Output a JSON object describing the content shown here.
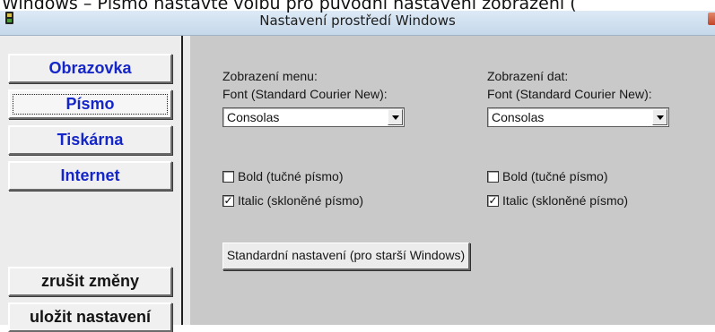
{
  "caption": "Windows – Písmo nastavte volbu pro původní nastavení zobrazení (",
  "window": {
    "title": "Nastavení prostředí Windows"
  },
  "sidebar": {
    "items": [
      {
        "label": "Obrazovka",
        "selected": false
      },
      {
        "label": "Písmo",
        "selected": true
      },
      {
        "label": "Tiskárna",
        "selected": false
      },
      {
        "label": "Internet",
        "selected": false
      }
    ],
    "cancel_label": "zrušit změny",
    "save_label": "uložit nastavení"
  },
  "menu_display": {
    "heading": "Zobrazení menu:",
    "font_label": "Font (Standard Courier New):",
    "font_value": "Consolas",
    "bold_label": "Bold (tučné písmo)",
    "bold_checked": false,
    "italic_label": "Italic (skloněné písmo)",
    "italic_checked": true
  },
  "data_display": {
    "heading": "Zobrazení dat:",
    "font_label": "Font (Standard Courier New):",
    "font_value": "Consolas",
    "bold_label": "Bold (tučné písmo)",
    "bold_checked": false,
    "italic_label": "Italic (skloněné písmo)",
    "italic_checked": true
  },
  "standard_button_label": "Standardní nastavení (pro starší Windows)",
  "check_mark": "✓",
  "colors": {
    "nav_text": "#1526c8",
    "panel_bg": "#c9c9c9",
    "sidebar_bg": "#ececec"
  }
}
